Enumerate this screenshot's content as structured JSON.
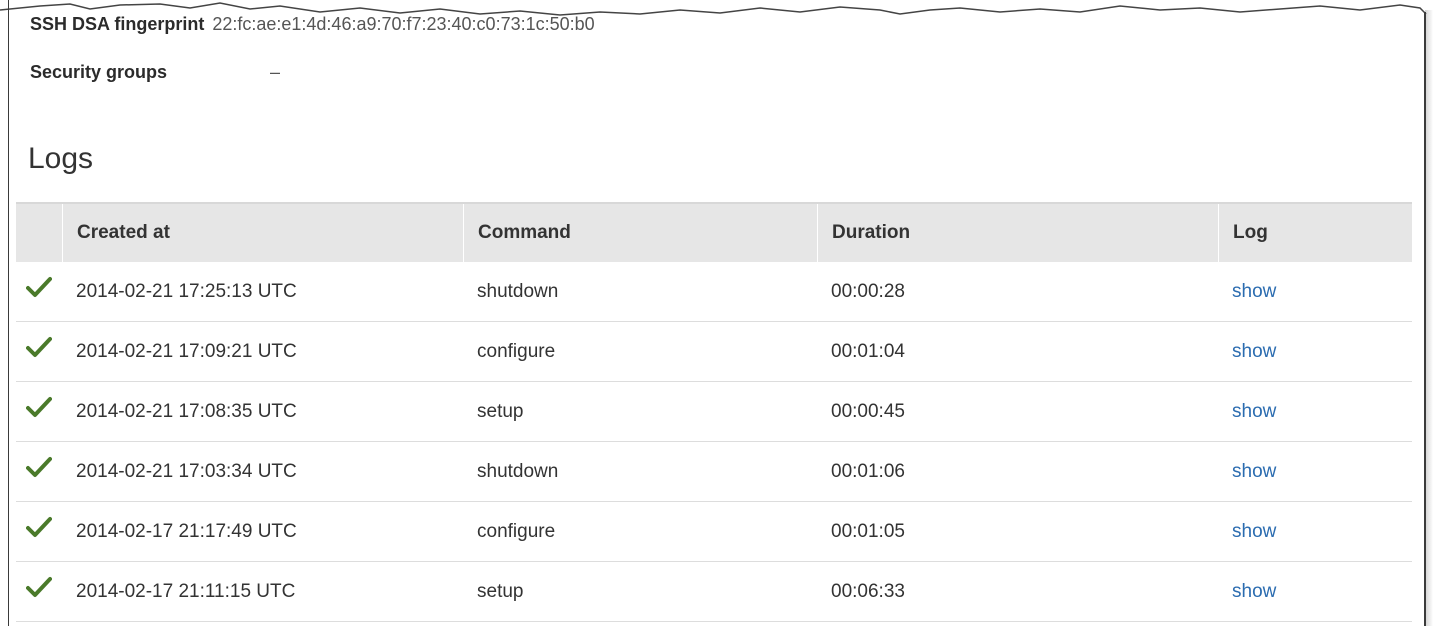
{
  "details": {
    "ssh_dsa_label": "SSH DSA fingerprint",
    "ssh_dsa_value": "22:fc:ae:e1:4d:46:a9:70:f7:23:40:c0:73:1c:50:b0",
    "security_groups_label": "Security groups",
    "security_groups_value": "–"
  },
  "logs": {
    "heading": "Logs",
    "columns": {
      "created_at": "Created at",
      "command": "Command",
      "duration": "Duration",
      "log": "Log"
    },
    "status_icon": "check-icon",
    "status_color": "#4a7a2a",
    "link_color": "#2b6cb0",
    "rows": [
      {
        "created_at": "2014-02-21 17:25:13 UTC",
        "command": "shutdown",
        "duration": "00:00:28",
        "log": "show"
      },
      {
        "created_at": "2014-02-21 17:09:21 UTC",
        "command": "configure",
        "duration": "00:01:04",
        "log": "show"
      },
      {
        "created_at": "2014-02-21 17:08:35 UTC",
        "command": "setup",
        "duration": "00:00:45",
        "log": "show"
      },
      {
        "created_at": "2014-02-21 17:03:34 UTC",
        "command": "shutdown",
        "duration": "00:01:06",
        "log": "show"
      },
      {
        "created_at": "2014-02-17 21:17:49 UTC",
        "command": "configure",
        "duration": "00:01:05",
        "log": "show"
      },
      {
        "created_at": "2014-02-17 21:11:15 UTC",
        "command": "setup",
        "duration": "00:06:33",
        "log": "show"
      }
    ]
  }
}
